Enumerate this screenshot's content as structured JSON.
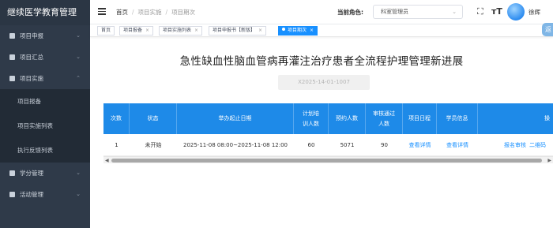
{
  "sidebar": {
    "brand": "继续医学教育管理",
    "items": [
      {
        "label": "项目申报"
      },
      {
        "label": "项目汇总"
      },
      {
        "label": "项目实施"
      },
      {
        "label": "学分管理"
      },
      {
        "label": "活动管理"
      }
    ],
    "submenu": [
      {
        "label": "项目报备"
      },
      {
        "label": "项目实施列表"
      },
      {
        "label": "执行反馈列表"
      }
    ]
  },
  "header": {
    "breadcrumb": [
      "首页",
      "项目实施",
      "项目期次"
    ],
    "role_label": "当前角色:",
    "role_value": "科室管理员",
    "username": "徐辉"
  },
  "tabs": [
    {
      "label": "首页"
    },
    {
      "label": "项目报备"
    },
    {
      "label": "项目实施列表"
    },
    {
      "label": "项目申报书【新版】"
    },
    {
      "label": "项目期次"
    }
  ],
  "side_button": "返",
  "main": {
    "title": "急性缺血性脑血管病再灌注治疗患者全流程护理管理新进展",
    "code": "X2025-14-01-1007"
  },
  "table": {
    "headers": [
      "次数",
      "状态",
      "举办起止日期",
      "计划培训人数",
      "预约人数",
      "审核通过人数",
      "项目日程",
      "学员信息",
      "操"
    ],
    "rows": [
      {
        "times": "1",
        "status": "未开始",
        "dates": "2025-11-08 08:00~2025-11-08 12:00",
        "planned": "60",
        "booked": "5071",
        "approved": "90",
        "schedule": "查看详情",
        "students": "查看详情",
        "action1": "报名审核",
        "action2": "二维码"
      }
    ]
  },
  "colors": {
    "sidebar_bg": "#2f3a49",
    "accent": "#1890ff",
    "table_header": "#1e8ae8"
  }
}
